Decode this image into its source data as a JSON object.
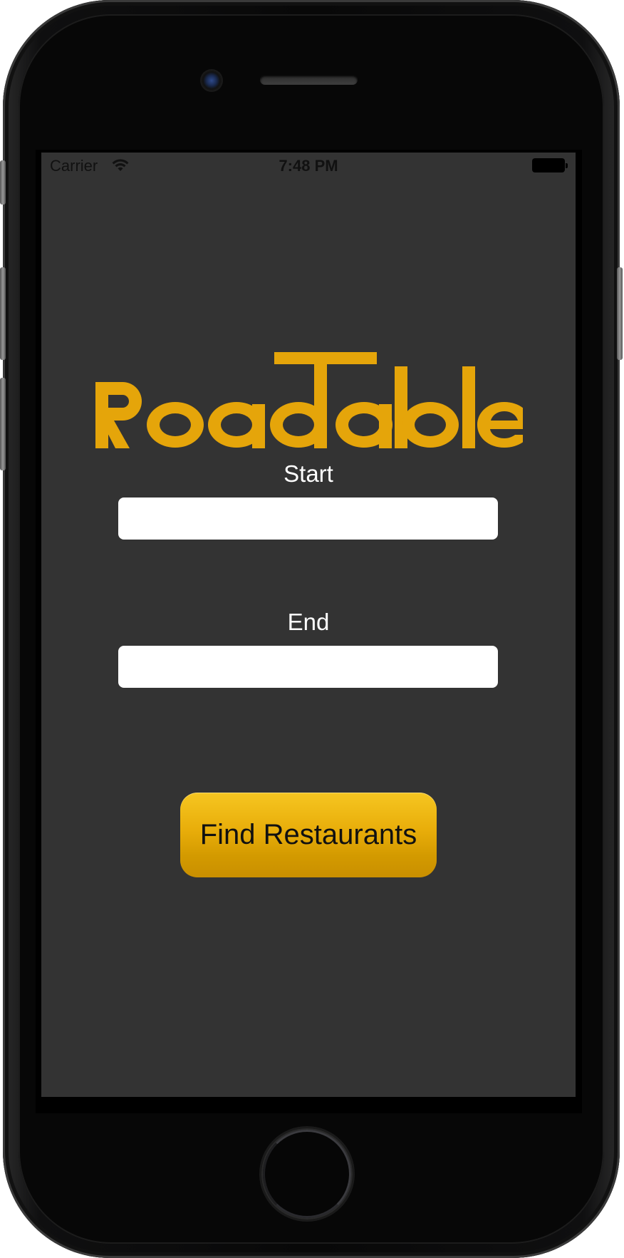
{
  "device": {
    "model": "iPhone"
  },
  "status_bar": {
    "carrier": "Carrier",
    "time": "7:48 PM"
  },
  "app": {
    "logo_text": "RoadTable",
    "brand_color": "#E5A50A",
    "background_color": "#333333"
  },
  "form": {
    "start_label": "Start",
    "start_value": "",
    "end_label": "End",
    "end_value": "",
    "submit_label": "Find Restaurants"
  },
  "icons": [
    "wifi-icon",
    "battery-icon",
    "front-camera-icon",
    "earpiece-speaker-icon",
    "home-button-icon"
  ]
}
